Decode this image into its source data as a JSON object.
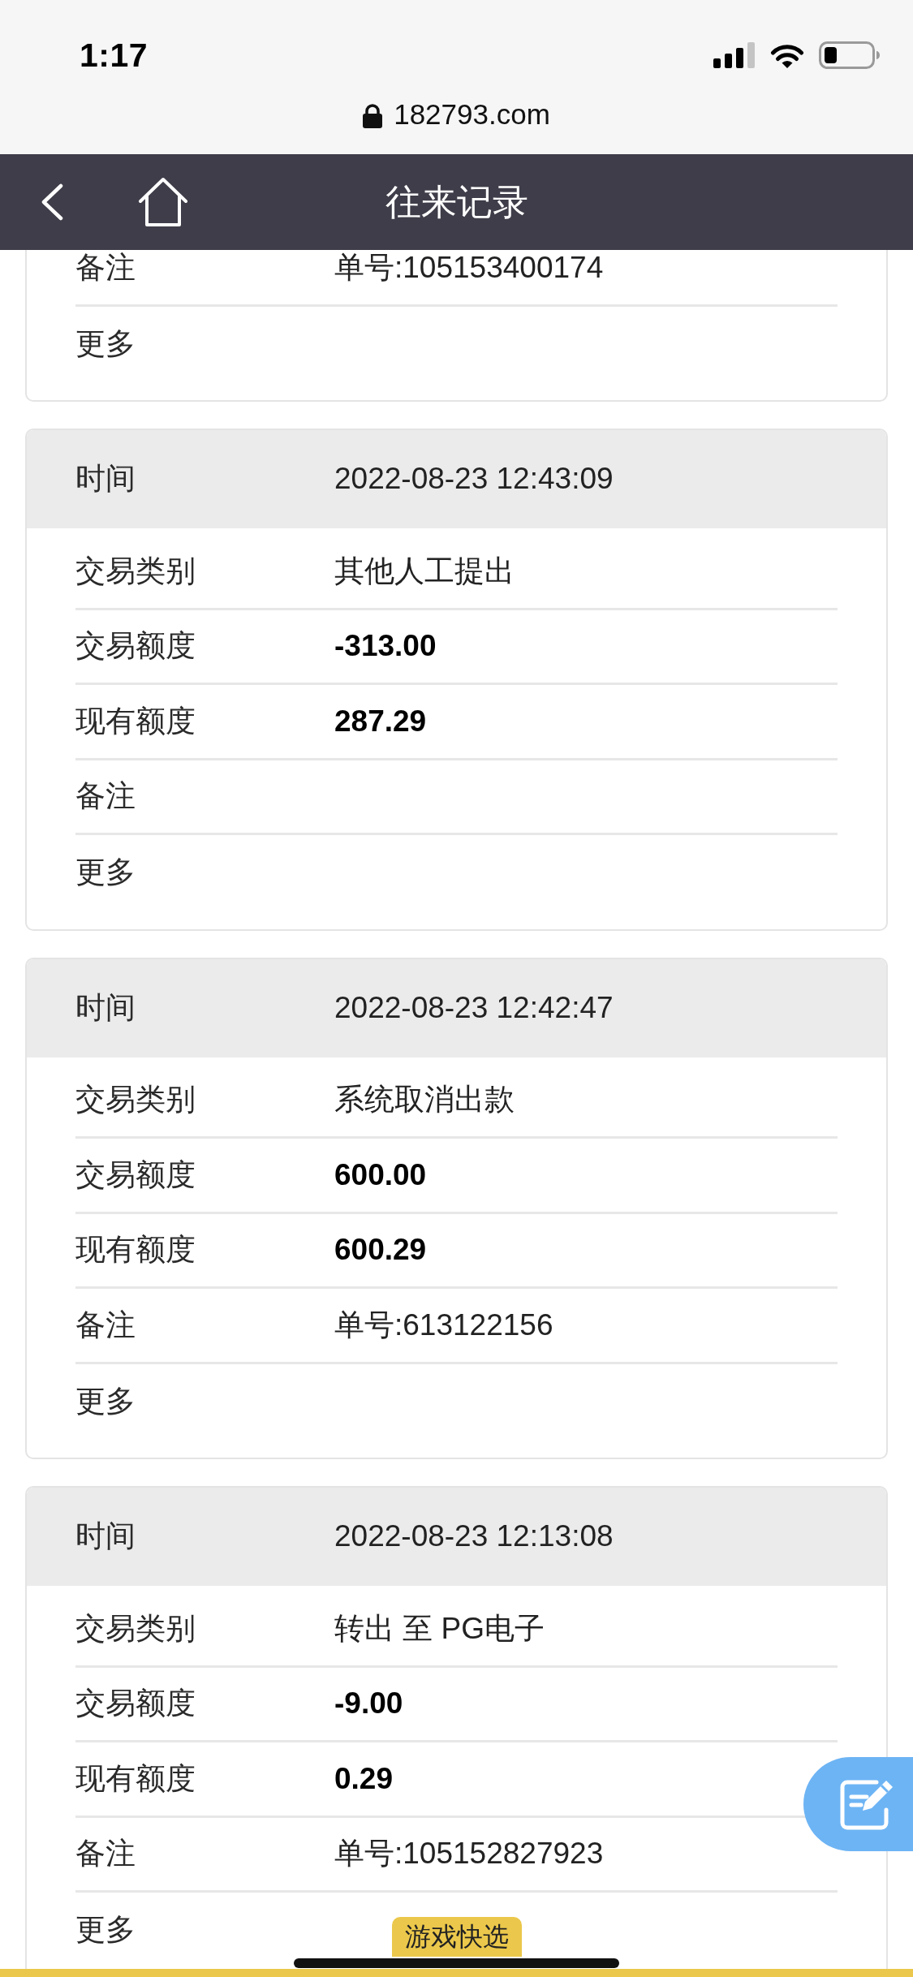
{
  "status_bar": {
    "time": "1:17"
  },
  "address_bar": {
    "url": "182793.com"
  },
  "nav_bar": {
    "title": "往来记录"
  },
  "records": [
    {
      "rows": [
        {
          "kind": "text",
          "label": "备注",
          "value": "单号:105153400174"
        },
        {
          "kind": "more",
          "label": "更多"
        }
      ]
    },
    {
      "header": {
        "label": "时间",
        "value": "2022-08-23 12:43:09"
      },
      "rows": [
        {
          "kind": "text",
          "label": "交易类别",
          "value": "其他人工提出"
        },
        {
          "kind": "amount",
          "label": "交易额度",
          "value": "-313.00"
        },
        {
          "kind": "amount",
          "label": "现有额度",
          "value": "287.29"
        },
        {
          "kind": "text",
          "label": "备注"
        },
        {
          "kind": "more",
          "label": "更多"
        }
      ]
    },
    {
      "header": {
        "label": "时间",
        "value": "2022-08-23 12:42:47"
      },
      "rows": [
        {
          "kind": "text",
          "label": "交易类别",
          "value": "系统取消出款"
        },
        {
          "kind": "amount",
          "label": "交易额度",
          "value": "600.00"
        },
        {
          "kind": "amount",
          "label": "现有额度",
          "value": "600.29"
        },
        {
          "kind": "text",
          "label": "备注",
          "value": "单号:613122156"
        },
        {
          "kind": "more",
          "label": "更多"
        }
      ]
    },
    {
      "header": {
        "label": "时间",
        "value": "2022-08-23 12:13:08"
      },
      "rows": [
        {
          "kind": "text",
          "label": "交易类别",
          "value": "转出 至 PG电子"
        },
        {
          "kind": "amount",
          "label": "交易额度",
          "value": "-9.00"
        },
        {
          "kind": "amount",
          "label": "现有额度",
          "value": "0.29"
        },
        {
          "kind": "text",
          "label": "备注",
          "value": "单号:105152827923"
        },
        {
          "kind": "more",
          "label": "更多"
        }
      ]
    }
  ],
  "bottom_bar": {
    "tab": "游戏快选"
  }
}
